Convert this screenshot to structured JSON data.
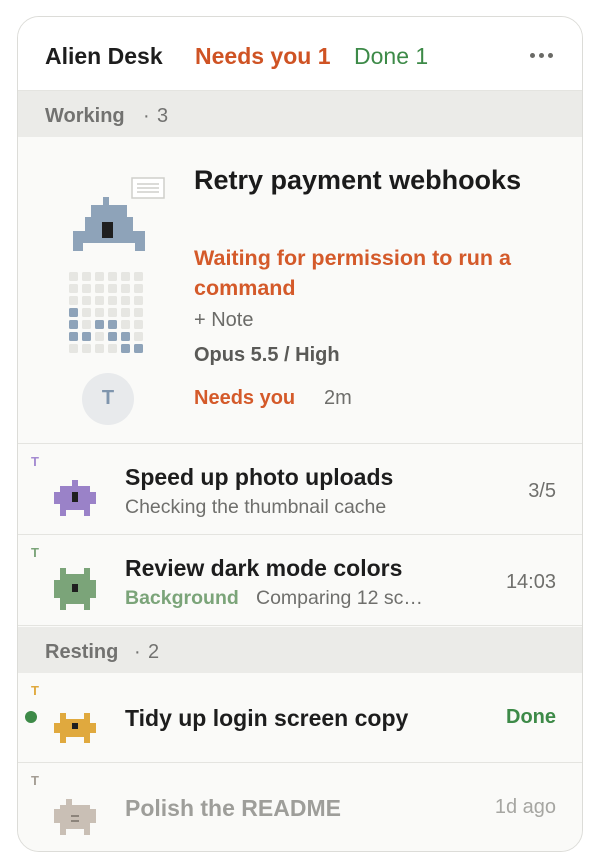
{
  "header": {
    "title": "Alien Desk",
    "needs_you": "Needs you 1",
    "done": "Done 1",
    "more_icon": "ellipsis-icon"
  },
  "sections": {
    "working": {
      "label": "Working",
      "separator": "·",
      "count": "3"
    },
    "resting": {
      "label": "Resting",
      "separator": "·",
      "count": "2"
    }
  },
  "featured": {
    "title": "Retry payment webhooks",
    "status": "Waiting for permission to run a command",
    "note": "+ Note",
    "model": "Opus 5.5 / High",
    "needs": "Needs you",
    "time": "2m",
    "avatar": "T",
    "icon": "alien-ship-icon",
    "progress_icon": "progress-grid-icon",
    "document_icon": "document-icon"
  },
  "rows": [
    {
      "tag": "T",
      "title": "Speed up photo uploads",
      "subtitle": "Checking the thumbnail cache",
      "meta": "3/5",
      "icon": "purple-alien-icon"
    },
    {
      "tag": "T",
      "title": "Review dark mode colors",
      "badge": "Background",
      "subtitle": "Comparing 12 sc…",
      "meta": "14:03",
      "icon": "green-alien-icon"
    },
    {
      "tag": "T",
      "title": "Tidy up login screen copy",
      "meta": "Done",
      "icon": "yellow-alien-icon"
    },
    {
      "tag": "T",
      "title": "Polish the README",
      "meta": "1d ago",
      "icon": "grey-alien-icon"
    }
  ],
  "colors": {
    "accent_orange": "#d45a2a",
    "done_green": "#3d8a48",
    "purple": "#9a82c8",
    "green": "#7ba479",
    "yellow": "#e0a93e",
    "blue": "#8ea3b9"
  }
}
